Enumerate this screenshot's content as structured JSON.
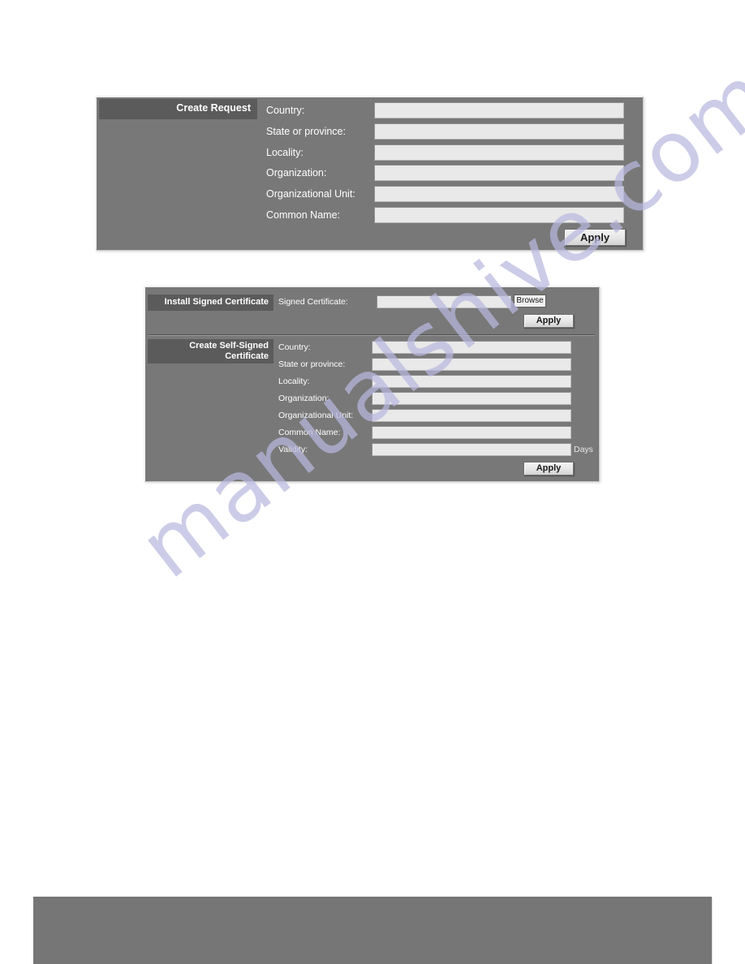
{
  "page": {
    "watermark_text": "manualshive.com",
    "background_color": "#ffffff",
    "panel_color": "#787878",
    "header_color": "#5b5b5b",
    "field_color": "#e9e9e9",
    "footer_color": "#767676"
  },
  "create_request_panel": {
    "header": "Create Request",
    "fields": [
      {
        "label": "Country:",
        "value": "",
        "placeholder": ""
      },
      {
        "label": "State or province:",
        "value": "",
        "placeholder": ""
      },
      {
        "label": "Locality:",
        "value": "",
        "placeholder": ""
      },
      {
        "label": "Organization:",
        "value": "",
        "placeholder": ""
      },
      {
        "label": "Organizational Unit:",
        "value": "",
        "placeholder": ""
      },
      {
        "label": "Common Name:",
        "value": "",
        "placeholder": ""
      }
    ],
    "apply_label": "Apply"
  },
  "certificates_panel": {
    "install_section": {
      "header": "Install Signed Certificate",
      "field_label": "Signed Certificate:",
      "field_value": "",
      "browse_label": "Browse",
      "apply_label": "Apply"
    },
    "self_signed_section": {
      "header_line1": "Create Self-Signed",
      "header_line2": "Certificate",
      "fields": [
        {
          "label": "Country:",
          "value": "",
          "unit": ""
        },
        {
          "label": "State or province:",
          "value": "",
          "unit": ""
        },
        {
          "label": "Locality:",
          "value": "",
          "unit": ""
        },
        {
          "label": "Organization:",
          "value": "",
          "unit": ""
        },
        {
          "label": "Organizational Unit:",
          "value": "",
          "unit": ""
        },
        {
          "label": "Common Name:",
          "value": "",
          "unit": ""
        },
        {
          "label": "Validity:",
          "value": "",
          "unit": "Days"
        }
      ],
      "apply_label": "Apply"
    }
  }
}
